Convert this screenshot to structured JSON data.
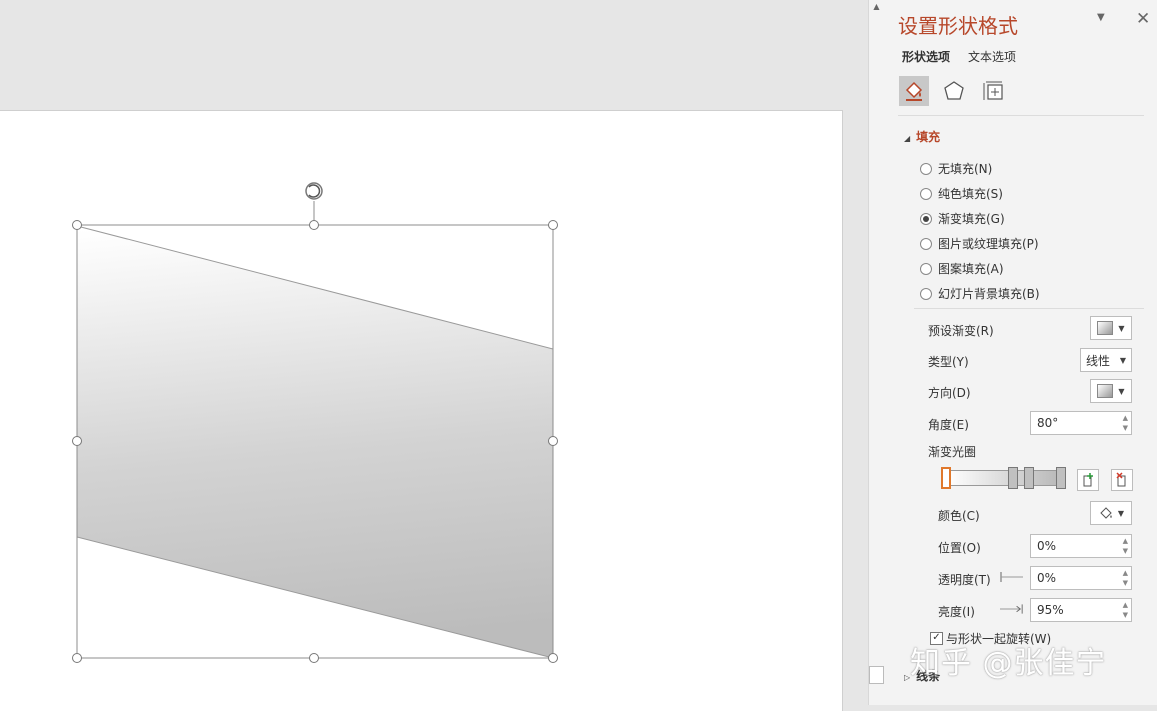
{
  "pane": {
    "title": "设置形状格式",
    "tabs": [
      "形状选项",
      "文本选项"
    ],
    "icons": [
      "fill-line-icon",
      "effects-pentagon-icon",
      "size-properties-icon"
    ],
    "fill_section": "填充",
    "fill_options": [
      {
        "label": "无填充(N)",
        "checked": false
      },
      {
        "label": "纯色填充(S)",
        "checked": false
      },
      {
        "label": "渐变填充(G)",
        "checked": true
      },
      {
        "label": "图片或纹理填充(P)",
        "checked": false
      },
      {
        "label": "图案填充(A)",
        "checked": false
      },
      {
        "label": "幻灯片背景填充(B)",
        "checked": false
      }
    ],
    "preset_label": "预设渐变(R)",
    "type_label": "类型(Y)",
    "type_value": "线性",
    "direction_label": "方向(D)",
    "angle_label": "角度(E)",
    "angle_value": "80°",
    "stops_label": "渐变光圈",
    "color_label": "颜色(C)",
    "position_label": "位置(O)",
    "position_value": "0%",
    "transparency_label": "透明度(T)",
    "transparency_value": "0%",
    "brightness_label": "亮度(I)",
    "brightness_value": "95%",
    "rotate_label": "与形状一起旋转(W)",
    "rotate_checked": true,
    "line_section": "线条"
  },
  "watermark": "知乎 @张佳宁",
  "colors": {
    "accent": "#b7472a",
    "pane_bg": "#f3f3f3",
    "selected_stop": "#e0782b"
  }
}
